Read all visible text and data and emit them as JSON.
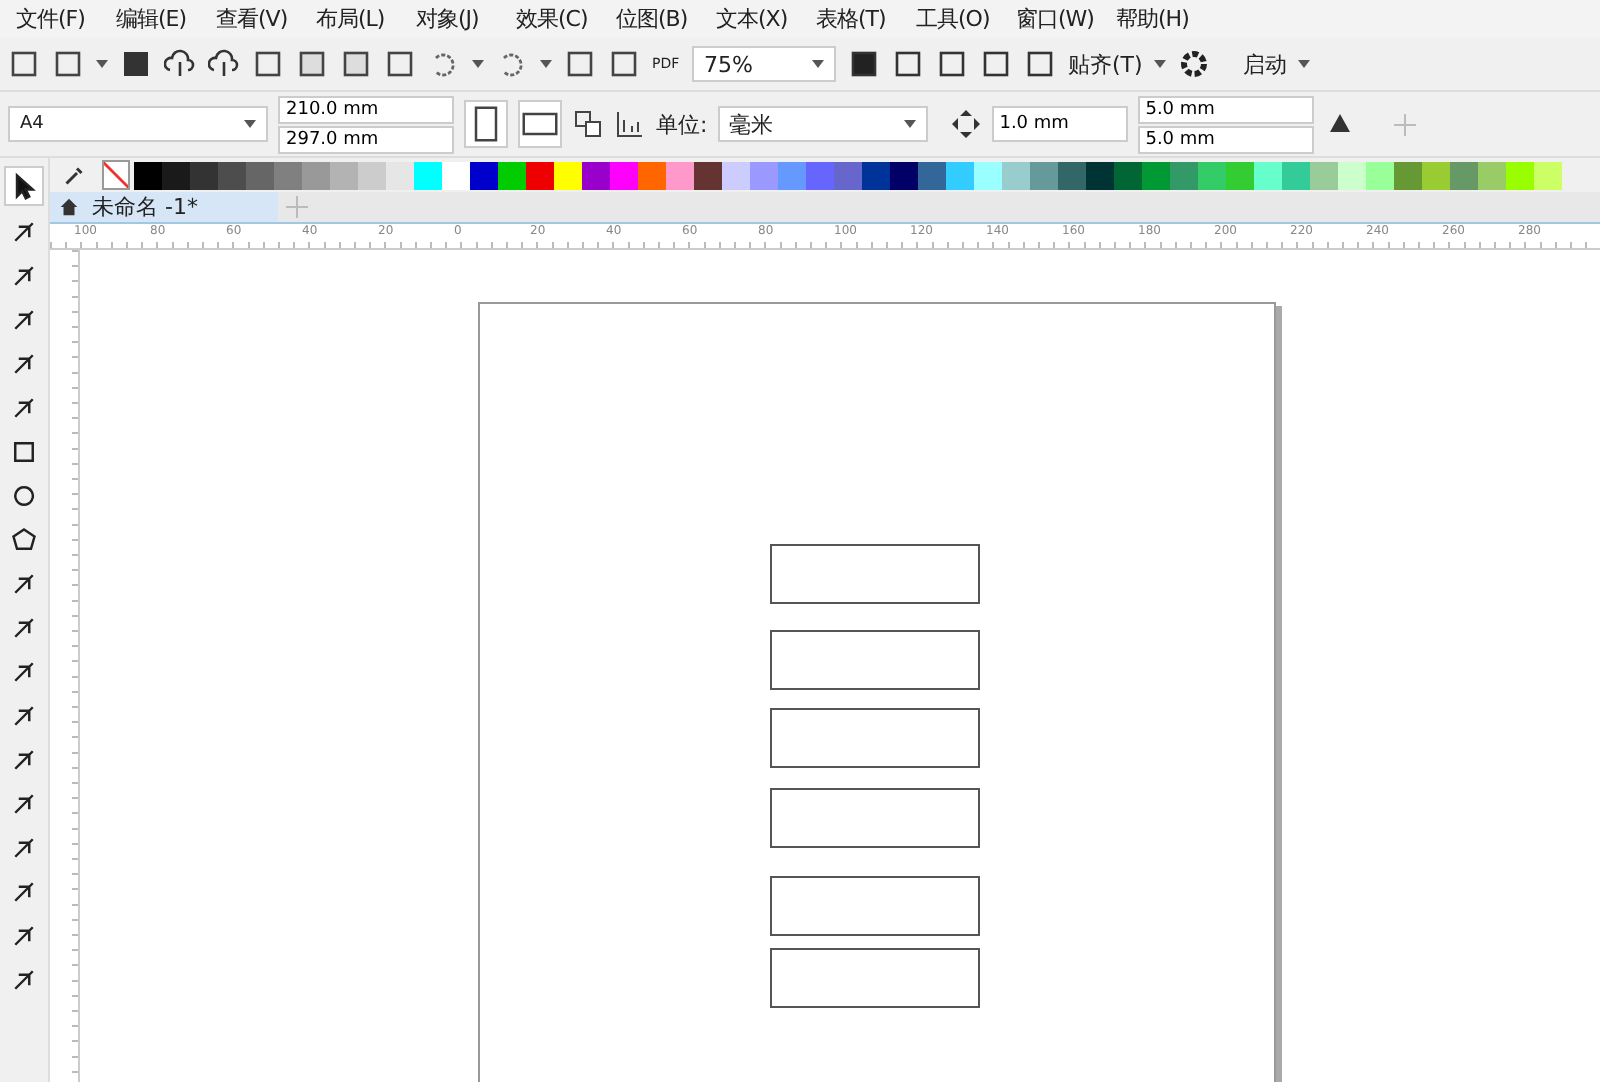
{
  "menu": [
    "文件(F)",
    "编辑(E)",
    "查看(V)",
    "布局(L)",
    "对象(J)",
    "效果(C)",
    "位图(B)",
    "文本(X)",
    "表格(T)",
    "工具(O)",
    "窗口(W)",
    "帮助(H)"
  ],
  "toolbar": {
    "pdf_label": "PDF",
    "zoom": "75%",
    "snap": "贴齐(T)",
    "launch": "启动"
  },
  "property_bar": {
    "page_size": "A4",
    "width": "210.0 mm",
    "height": "297.0 mm",
    "unit_label": "单位:",
    "unit": "毫米",
    "nudge": "1.0 mm",
    "dup_x": "5.0 mm",
    "dup_y": "5.0 mm"
  },
  "palette": [
    {
      "color": "#000000"
    },
    {
      "color": "#1a1a1a"
    },
    {
      "color": "#333333"
    },
    {
      "color": "#4d4d4d"
    },
    {
      "color": "#666666"
    },
    {
      "color": "#808080"
    },
    {
      "color": "#999999"
    },
    {
      "color": "#b3b3b3"
    },
    {
      "color": "#cccccc"
    },
    {
      "color": "#e6e6e6"
    },
    {
      "color": "#00ffff"
    },
    {
      "color": "#ffffff"
    },
    {
      "color": "#0000cc"
    },
    {
      "color": "#00cc00"
    },
    {
      "color": "#ee0000"
    },
    {
      "color": "#ffff00"
    },
    {
      "color": "#9900cc"
    },
    {
      "color": "#ff00ff"
    },
    {
      "color": "#ff6600"
    },
    {
      "color": "#ff99cc"
    },
    {
      "color": "#663333"
    },
    {
      "color": "#ccccff"
    },
    {
      "color": "#9999ff"
    },
    {
      "color": "#6699ff"
    },
    {
      "color": "#6666ff"
    },
    {
      "color": "#6666cc"
    },
    {
      "color": "#003399"
    },
    {
      "color": "#000066"
    },
    {
      "color": "#336699"
    },
    {
      "color": "#33ccff"
    },
    {
      "color": "#99ffff"
    },
    {
      "color": "#99cccc"
    },
    {
      "color": "#669999"
    },
    {
      "color": "#336666"
    },
    {
      "color": "#003333"
    },
    {
      "color": "#006633"
    },
    {
      "color": "#009933"
    },
    {
      "color": "#339966"
    },
    {
      "color": "#33cc66"
    },
    {
      "color": "#33cc33"
    },
    {
      "color": "#66ffcc"
    },
    {
      "color": "#33cc99"
    },
    {
      "color": "#99cc99"
    },
    {
      "color": "#ccffcc"
    },
    {
      "color": "#99ff99"
    },
    {
      "color": "#669933"
    },
    {
      "color": "#99cc33"
    },
    {
      "color": "#669966"
    },
    {
      "color": "#99cc66"
    },
    {
      "color": "#99ff00"
    },
    {
      "color": "#ccff66"
    }
  ],
  "document_tab": {
    "title": "未命名 -1*",
    "selected": true
  },
  "ruler_labels": [
    "100",
    "80",
    "60",
    "40",
    "20",
    "0",
    "20",
    "40",
    "60",
    "80",
    "100",
    "120",
    "140",
    "160",
    "180",
    "200",
    "220",
    "240",
    "260",
    "280"
  ],
  "toolbox": [
    {
      "selected": true
    },
    {
      "selected": false
    },
    {
      "selected": false
    },
    {
      "selected": false
    },
    {
      "selected": false
    },
    {
      "selected": false
    },
    {
      "selected": false
    },
    {
      "selected": false
    },
    {
      "selected": false
    },
    {
      "selected": false
    },
    {
      "selected": false
    },
    {
      "selected": false
    },
    {
      "selected": false
    },
    {
      "selected": false
    },
    {
      "selected": false
    },
    {
      "selected": false
    },
    {
      "selected": false
    },
    {
      "selected": false
    },
    {
      "selected": false
    }
  ],
  "rectangles": [
    {
      "selected": false
    },
    {
      "selected": false
    },
    {
      "selected": false
    },
    {
      "selected": false
    },
    {
      "selected": false
    },
    {
      "selected": false
    }
  ]
}
